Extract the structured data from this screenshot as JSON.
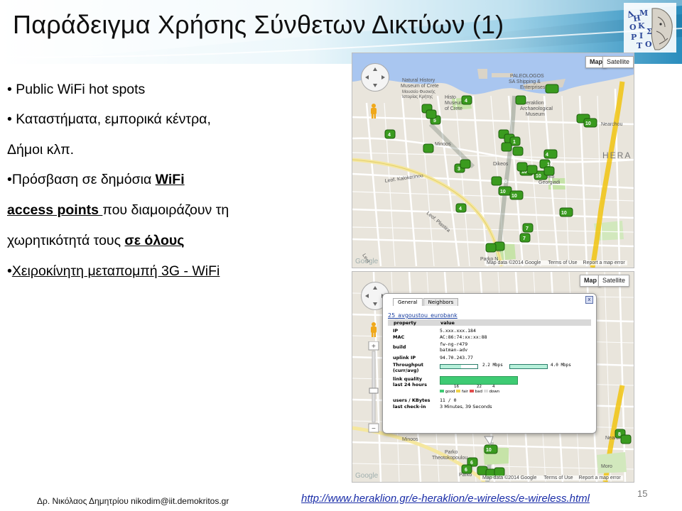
{
  "slide": {
    "title": "Παράδειγμα Χρήσης Σύνθετων Δικτύων (1)",
    "page_number": "15",
    "colors": {
      "header_gradient_start": "#f4fbfd",
      "header_gradient_end": "#2f93c1",
      "title_color": "#101010",
      "link_color": "#1a2da8",
      "map_green": "#3a9b1f"
    }
  },
  "logo": {
    "text": "ΔΗΜΟΚΡΙΤΟΣ",
    "icon": "democritus-head-logo"
  },
  "bullets": {
    "b1": "• Public WiFi hot spots",
    "b2": "• Καταστήματα, εμπορικά κέντρα,",
    "b2_cont": "Δήμοι κλπ.",
    "b3_pre": "•Πρόσβαση σε δημόσια ",
    "b3_bold": "WiFi",
    "b3b_bold": "access points ",
    "b3b_rest": "που διαμοιράζουν τη",
    "b3c_pre": "χωρητικότητά τους ",
    "b3c_bold": "σε όλους",
    "b4_pre": "•",
    "b4_u": "Χειροκίνητη μεταπομπή 3G - WiFi"
  },
  "map_top": {
    "map_button": "Map",
    "satellite_button": "Satellite",
    "attribution": "Map data ©2014 Google",
    "terms": "Terms of Use",
    "report": "Report a map error",
    "labels": {
      "museum1": "Natural History",
      "museum2": "Museum of Crete",
      "museum3": "Μουσείο Φυσικής",
      "museum4": "Ιστορίας Κρήτης",
      "paleologos1": "PALEOLOGOS",
      "paleologos2": "SA Shipping &",
      "paleologos3": "Enterprises",
      "archaeo1": "Heraklion",
      "archaeo2": "Archaeological",
      "archaeo3": "Museum",
      "nearchou": "Nearchou",
      "hera": "HERA",
      "kalokerinou": "Leof. Kalokerinou",
      "plastira": "Leof. Plastira",
      "dikeos": "Dikeos",
      "georgiadi1": "Parko",
      "georgiadi2": "Georgiadi",
      "minoos": "Minoos",
      "parko": "Parko N",
      "histo1": "Histo",
      "histo2": "Museum",
      "histo3": "of Crete",
      "leof": "Leof"
    },
    "markers": [
      "4",
      "4",
      "5",
      "10",
      "4",
      "10",
      "10",
      "10",
      "10",
      "10",
      "7",
      "7",
      "4",
      "3",
      "10",
      "10",
      "1",
      "10"
    ]
  },
  "map_bottom": {
    "map_button": "Map",
    "satellite_button": "Satellite",
    "attribution": "Map data ©2014 Google",
    "terms": "Terms of Use",
    "report": "Report a map error",
    "labels": {
      "theotokopoulou1": "Parko",
      "theotokopoulou2": "Theotokopoulou",
      "minoos": "Minoos",
      "parko": "Parko",
      "moro": "Moro",
      "nearch": "Nearch"
    },
    "markers": [
      "10",
      "6",
      "6",
      "8"
    ],
    "popup": {
      "tab_general": "General",
      "tab_neighbors": "Neighbors",
      "close": "x",
      "node_name": "25_avgoustou_eurobank",
      "col_property": "property",
      "col_value": "value",
      "ip_key": "IP",
      "ip_val": "5.xxx.xxx.184",
      "mac_key": "MAC",
      "mac_val": "AC:86:74:xx:xx:88",
      "build_key": "build",
      "build_val1": "fw-ng-r479",
      "build_val2": "batman-adv",
      "uplink_key": "uplink IP",
      "uplink_val": "94.70.243.77",
      "throughput_key1": "Throughput",
      "throughput_key2": "(curr/avg)",
      "throughput_curr": "2.2 Mbps",
      "throughput_avg": "4.0 Mbps",
      "throughput_curr_fraction": 0.55,
      "throughput_avg_fraction": 1.0,
      "lq_key1": "link quality",
      "lq_key2": "last 24 hours",
      "lq_n1": "16",
      "lq_n2": "22",
      "lq_n3": "4",
      "lq_good": "good",
      "lq_fair": "fair",
      "lq_bad": "bad",
      "lq_down": "down",
      "users_key": "users / KBytes",
      "users_val": "11 / 0",
      "checkin_key": "last check-in",
      "checkin_val": "3 Minutes, 39 Seconds"
    }
  },
  "footer": {
    "author": "Δρ. Νικόλαος Δημητρίου nikodim@iit.demokritos.gr",
    "link": "http://www.heraklion.gr/e-heraklion/e-wireless/e-wireless.html"
  }
}
